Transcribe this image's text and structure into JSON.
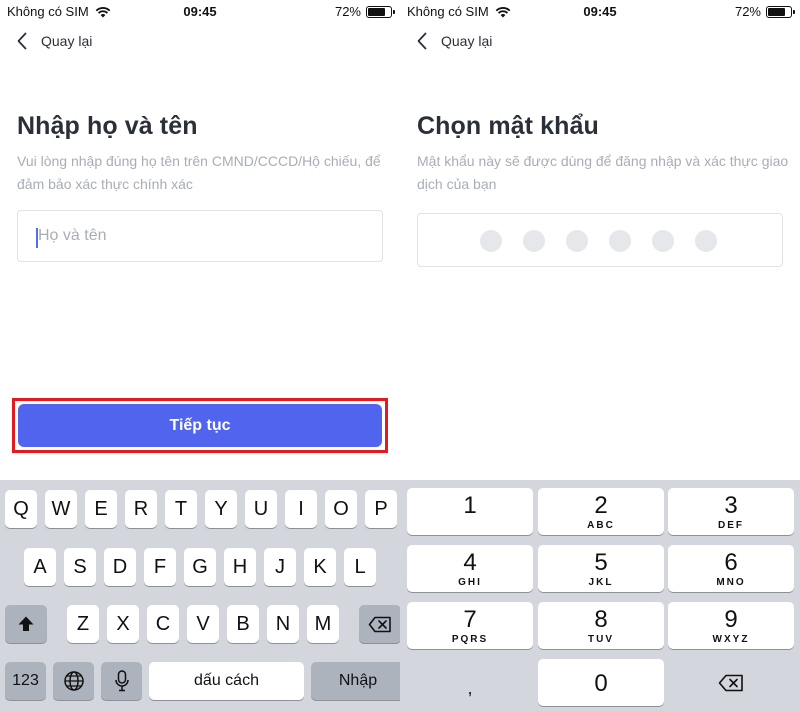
{
  "status_bar": {
    "carrier": "Không có SIM",
    "time": "09:45",
    "battery": "72%",
    "battery_level": 0.72
  },
  "left_screen": {
    "back_label": "Quay lại",
    "title": "Nhập họ và tên",
    "subtitle": "Vui lòng nhập đúng họ tên trên CMND/CCCD/Hộ chiếu, để đảm bảo xác thực chính xác",
    "name_input": {
      "placeholder": "Họ và tên",
      "value": ""
    },
    "continue_label": "Tiếp tục",
    "highlight_color": "#e01b22",
    "button_color": "#5064ee"
  },
  "right_screen": {
    "back_label": "Quay lại",
    "title": "Chọn mật khẩu",
    "subtitle": "Mật khẩu này sẽ được dùng để đăng nhập và xác thực giao dịch của bạn",
    "pin_length": 6
  },
  "keyboard_qwerty": {
    "row1": [
      "Q",
      "W",
      "E",
      "R",
      "T",
      "Y",
      "U",
      "I",
      "O",
      "P"
    ],
    "row2": [
      "A",
      "S",
      "D",
      "F",
      "G",
      "H",
      "J",
      "K",
      "L"
    ],
    "row3": [
      "Z",
      "X",
      "C",
      "V",
      "B",
      "N",
      "M"
    ],
    "shift_icon": "shift-arrow-icon",
    "delete_icon": "backspace-icon",
    "numbers_label": "123",
    "globe_icon": "globe-icon",
    "mic_icon": "microphone-icon",
    "space_label": "dấu cách",
    "return_label": "Nhập"
  },
  "keypad_numeric": {
    "keys": [
      {
        "digit": "1",
        "letters": ""
      },
      {
        "digit": "2",
        "letters": "ABC"
      },
      {
        "digit": "3",
        "letters": "DEF"
      },
      {
        "digit": "4",
        "letters": "GHI"
      },
      {
        "digit": "5",
        "letters": "JKL"
      },
      {
        "digit": "6",
        "letters": "MNO"
      },
      {
        "digit": "7",
        "letters": "PQRS"
      },
      {
        "digit": "8",
        "letters": "TUV"
      },
      {
        "digit": "9",
        "letters": "WXYZ"
      }
    ],
    "comma": ",",
    "zero": "0",
    "delete_icon": "backspace-icon"
  }
}
